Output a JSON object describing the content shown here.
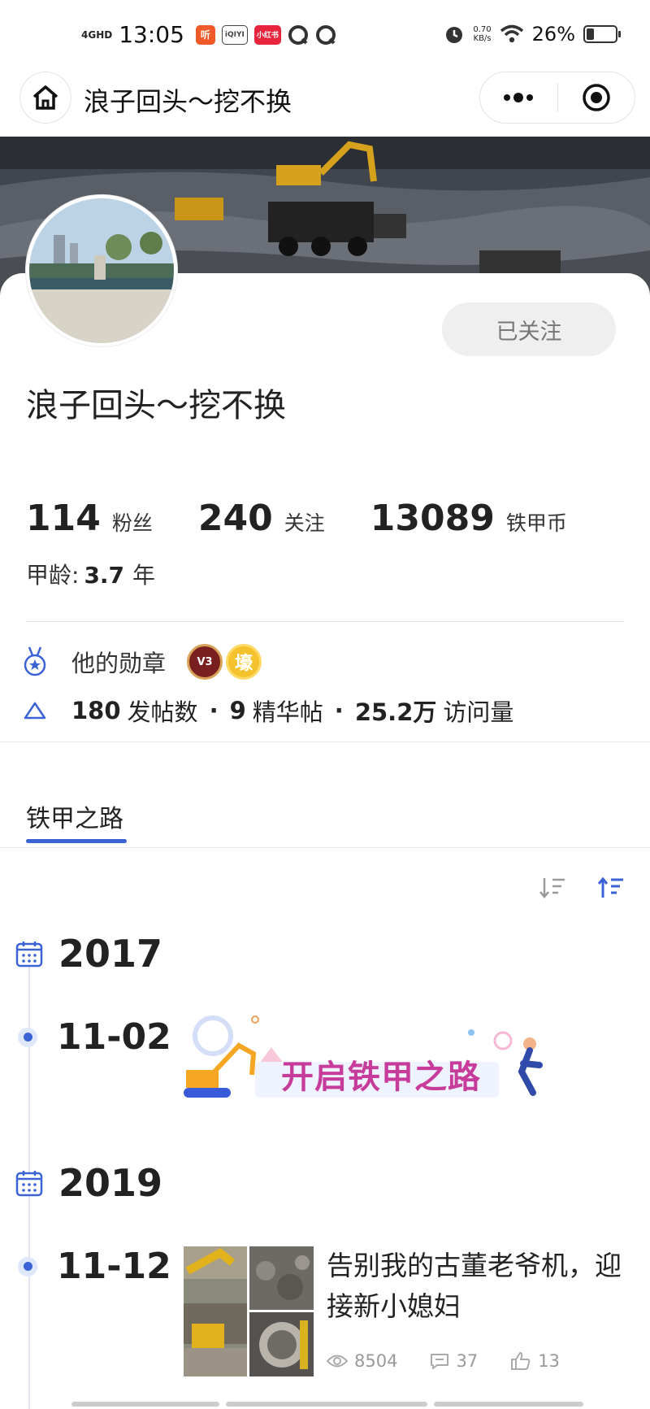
{
  "status_bar": {
    "network": "4GHD",
    "time": "13:05",
    "apps": [
      {
        "label": "听",
        "color": "#f05a28"
      },
      {
        "label": "iQIYI",
        "color": "#555555"
      },
      {
        "label": "小红书",
        "color": "#e8253c"
      }
    ],
    "speed_value": "0.70",
    "speed_unit": "KB/s",
    "battery_text": "26%",
    "battery_level": 0.26
  },
  "navbar": {
    "title": "浪子回头～挖不换"
  },
  "profile": {
    "name": "浪子回头～挖不换",
    "follow_label": "已关注",
    "stats": [
      {
        "value": "114",
        "label": "粉丝"
      },
      {
        "value": "240",
        "label": "关注"
      },
      {
        "value": "13089",
        "label": "铁甲币"
      }
    ],
    "age_label": "甲龄:",
    "age_value": "3.7",
    "age_unit": "年"
  },
  "medals": {
    "label": "他的勋章",
    "badges": [
      {
        "label": "V3"
      },
      {
        "label": "壕"
      }
    ]
  },
  "posts_summary": {
    "posts_count": "180",
    "posts_label": "发帖数",
    "separator": "·",
    "featured_count": "9",
    "featured_label": "精华帖",
    "visits_count": "25.2万",
    "visits_label": "访问量"
  },
  "tabs": {
    "active": "铁甲之路"
  },
  "timeline": {
    "year1": "2017",
    "date1": "11-02",
    "banner_text": "开启铁甲之路",
    "year2": "2019",
    "date2": "11-12",
    "post": {
      "title": "告别我的古董老爷机，迎接新小媳妇",
      "views": "8504",
      "comments": "37",
      "likes": "13"
    }
  },
  "colors": {
    "accent": "#3c63d6",
    "banner_pink": "#c73c9a"
  }
}
